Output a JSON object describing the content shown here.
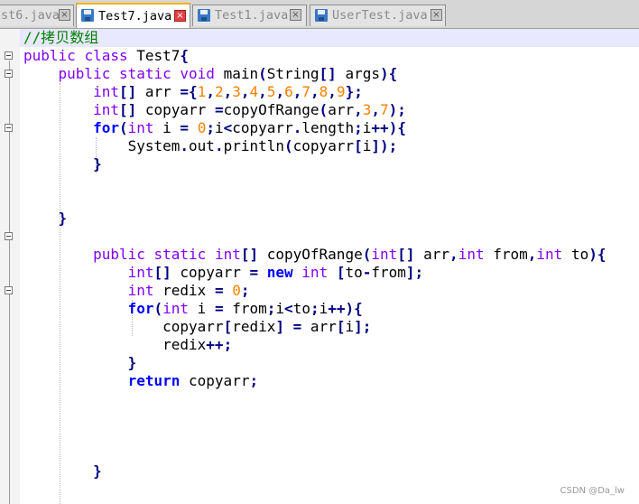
{
  "tabs": [
    {
      "label": "st6.java",
      "active": false
    },
    {
      "label": "Test7.java",
      "active": true
    },
    {
      "label": "Test1.java",
      "active": false
    },
    {
      "label": "UserTest.java",
      "active": false
    }
  ],
  "tab_close_glyph": "×",
  "watermark": "CSDN @Da_lw",
  "colors": {
    "keyword": "#8000ff",
    "flow_keyword": "#0000ff",
    "operator": "#000080",
    "number": "#ff8000",
    "comment": "#008000",
    "current_line": "#e8e8ff",
    "gutter": "#f3f3f3",
    "active_tab_accent": "#f4b400"
  },
  "code": [
    [
      [
        "cm",
        "//拷贝数组"
      ]
    ],
    [
      [
        "kw",
        "public"
      ],
      [
        "pl",
        " "
      ],
      [
        "kw",
        "class"
      ],
      [
        "pl",
        " Test7"
      ],
      [
        "op",
        "{"
      ]
    ],
    [
      [
        "pl",
        "    "
      ],
      [
        "kw",
        "public"
      ],
      [
        "pl",
        " "
      ],
      [
        "kw",
        "static"
      ],
      [
        "pl",
        " "
      ],
      [
        "kw",
        "void"
      ],
      [
        "pl",
        " main"
      ],
      [
        "op",
        "("
      ],
      [
        "pl",
        "String"
      ],
      [
        "op",
        "[]"
      ],
      [
        "pl",
        " args"
      ],
      [
        "op",
        "){"
      ]
    ],
    [
      [
        "pl",
        "        "
      ],
      [
        "kw",
        "int"
      ],
      [
        "op",
        "[]"
      ],
      [
        "pl",
        " arr "
      ],
      [
        "op",
        "={"
      ],
      [
        "num",
        "1"
      ],
      [
        "op",
        ","
      ],
      [
        "num",
        "2"
      ],
      [
        "op",
        ","
      ],
      [
        "num",
        "3"
      ],
      [
        "op",
        ","
      ],
      [
        "num",
        "4"
      ],
      [
        "op",
        ","
      ],
      [
        "num",
        "5"
      ],
      [
        "op",
        ","
      ],
      [
        "num",
        "6"
      ],
      [
        "op",
        ","
      ],
      [
        "num",
        "7"
      ],
      [
        "op",
        ","
      ],
      [
        "num",
        "8"
      ],
      [
        "op",
        ","
      ],
      [
        "num",
        "9"
      ],
      [
        "op",
        "};"
      ]
    ],
    [
      [
        "pl",
        "        "
      ],
      [
        "kw",
        "int"
      ],
      [
        "op",
        "[]"
      ],
      [
        "pl",
        " copyarr "
      ],
      [
        "op",
        "="
      ],
      [
        "pl",
        "copyOfRange"
      ],
      [
        "op",
        "("
      ],
      [
        "pl",
        "arr"
      ],
      [
        "op",
        ","
      ],
      [
        "num",
        "3"
      ],
      [
        "op",
        ","
      ],
      [
        "num",
        "7"
      ],
      [
        "op",
        ");"
      ]
    ],
    [
      [
        "pl",
        "        "
      ],
      [
        "bkw",
        "for"
      ],
      [
        "op",
        "("
      ],
      [
        "kw",
        "int"
      ],
      [
        "pl",
        " i "
      ],
      [
        "op",
        "="
      ],
      [
        "pl",
        " "
      ],
      [
        "num",
        "0"
      ],
      [
        "op",
        ";"
      ],
      [
        "pl",
        "i"
      ],
      [
        "op",
        "<"
      ],
      [
        "pl",
        "copyarr"
      ],
      [
        "op",
        "."
      ],
      [
        "pl",
        "length"
      ],
      [
        "op",
        ";"
      ],
      [
        "pl",
        "i"
      ],
      [
        "op",
        "++){"
      ]
    ],
    [
      [
        "pl",
        "            System"
      ],
      [
        "op",
        "."
      ],
      [
        "pl",
        "out"
      ],
      [
        "op",
        "."
      ],
      [
        "pl",
        "println"
      ],
      [
        "op",
        "("
      ],
      [
        "pl",
        "copyarr"
      ],
      [
        "op",
        "["
      ],
      [
        "pl",
        "i"
      ],
      [
        "op",
        "]);"
      ]
    ],
    [
      [
        "pl",
        "        "
      ],
      [
        "op",
        "}"
      ]
    ],
    [],
    [],
    [
      [
        "pl",
        "    "
      ],
      [
        "op",
        "}"
      ]
    ],
    [],
    [
      [
        "pl",
        "        "
      ],
      [
        "kw",
        "public"
      ],
      [
        "pl",
        " "
      ],
      [
        "kw",
        "static"
      ],
      [
        "pl",
        " "
      ],
      [
        "kw",
        "int"
      ],
      [
        "op",
        "[]"
      ],
      [
        "pl",
        " copyOfRange"
      ],
      [
        "op",
        "("
      ],
      [
        "kw",
        "int"
      ],
      [
        "op",
        "[]"
      ],
      [
        "pl",
        " arr"
      ],
      [
        "op",
        ","
      ],
      [
        "kw",
        "int"
      ],
      [
        "pl",
        " from"
      ],
      [
        "op",
        ","
      ],
      [
        "kw",
        "int"
      ],
      [
        "pl",
        " to"
      ],
      [
        "op",
        "){"
      ]
    ],
    [
      [
        "pl",
        "            "
      ],
      [
        "kw",
        "int"
      ],
      [
        "op",
        "[]"
      ],
      [
        "pl",
        " copyarr "
      ],
      [
        "op",
        "="
      ],
      [
        "pl",
        " "
      ],
      [
        "bkw",
        "new"
      ],
      [
        "pl",
        " "
      ],
      [
        "kw",
        "int"
      ],
      [
        "pl",
        " "
      ],
      [
        "op",
        "["
      ],
      [
        "pl",
        "to"
      ],
      [
        "op",
        "-"
      ],
      [
        "pl",
        "from"
      ],
      [
        "op",
        "];"
      ]
    ],
    [
      [
        "pl",
        "            "
      ],
      [
        "kw",
        "int"
      ],
      [
        "pl",
        " redix "
      ],
      [
        "op",
        "="
      ],
      [
        "pl",
        " "
      ],
      [
        "num",
        "0"
      ],
      [
        "op",
        ";"
      ]
    ],
    [
      [
        "pl",
        "            "
      ],
      [
        "bkw",
        "for"
      ],
      [
        "op",
        "("
      ],
      [
        "kw",
        "int"
      ],
      [
        "pl",
        " i "
      ],
      [
        "op",
        "="
      ],
      [
        "pl",
        " from"
      ],
      [
        "op",
        ";"
      ],
      [
        "pl",
        "i"
      ],
      [
        "op",
        "<"
      ],
      [
        "pl",
        "to"
      ],
      [
        "op",
        ";"
      ],
      [
        "pl",
        "i"
      ],
      [
        "op",
        "++){"
      ]
    ],
    [
      [
        "pl",
        "                copyarr"
      ],
      [
        "op",
        "["
      ],
      [
        "pl",
        "redix"
      ],
      [
        "op",
        "]"
      ],
      [
        "pl",
        " "
      ],
      [
        "op",
        "="
      ],
      [
        "pl",
        " arr"
      ],
      [
        "op",
        "["
      ],
      [
        "pl",
        "i"
      ],
      [
        "op",
        "];"
      ]
    ],
    [
      [
        "pl",
        "                redix"
      ],
      [
        "op",
        "++;"
      ]
    ],
    [
      [
        "pl",
        "            "
      ],
      [
        "op",
        "}"
      ]
    ],
    [
      [
        "pl",
        "            "
      ],
      [
        "bkw",
        "return"
      ],
      [
        "pl",
        " copyarr"
      ],
      [
        "op",
        ";"
      ]
    ],
    [],
    [],
    [],
    [],
    [
      [
        "pl",
        "        "
      ],
      [
        "op",
        "}"
      ]
    ]
  ]
}
